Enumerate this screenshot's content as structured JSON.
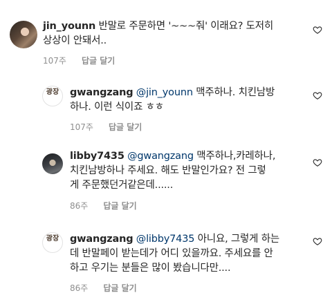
{
  "comments": [
    {
      "username": "jin_younn",
      "avatar": "profile-photo",
      "lines": [
        [
          {
            "t": "jin_younn",
            "k": "user"
          },
          {
            "t": " 반말로 주문하면 '~~~줘' 이래요? 도저히",
            "k": "text"
          }
        ],
        [
          {
            "t": "상상이 안돼서..",
            "k": "text"
          }
        ]
      ],
      "time": "107주",
      "reply": "답글 달기"
    },
    {
      "username": "gwangzang",
      "avatar": "brand-logo",
      "avatar_text": "광장",
      "lines": [
        [
          {
            "t": "gwangzang",
            "k": "user"
          },
          {
            "t": " @jin_younn",
            "k": "mention"
          },
          {
            "t": "  맥주하나. 치킨남방",
            "k": "text"
          }
        ],
        [
          {
            "t": "하나. 이런 식이죠 ㅎㅎ",
            "k": "text"
          }
        ]
      ],
      "time": "107주",
      "reply": "답글 달기"
    },
    {
      "username": "libby7435",
      "avatar": "profile-photo-dark",
      "lines": [
        [
          {
            "t": "libby7435",
            "k": "user"
          },
          {
            "t": " @gwangzang",
            "k": "mention"
          },
          {
            "t": "  맥주하나,카레하나,",
            "k": "text"
          }
        ],
        [
          {
            "t": "치킨남방하나  주세요. 해도 반말인가요? 전 그렇",
            "k": "text"
          }
        ],
        [
          {
            "t": "게 주문했던거같은데......",
            "k": "text"
          }
        ]
      ],
      "time": "86주",
      "reply": "답글 달기"
    },
    {
      "username": "gwangzang",
      "avatar": "brand-logo",
      "avatar_text": "광장",
      "lines": [
        [
          {
            "t": "gwangzang",
            "k": "user"
          },
          {
            "t": " @libby7435",
            "k": "mention"
          },
          {
            "t": " 아니요, 그렇게 하는",
            "k": "text"
          }
        ],
        [
          {
            "t": "데 반말페이 받는데가 어디 있을까요. 주세요를 안",
            "k": "text"
          }
        ],
        [
          {
            "t": "하고 우기는 분들은 많이 봤습니다만....",
            "k": "text"
          }
        ]
      ],
      "time": "86주",
      "reply": "답글 달기"
    }
  ],
  "colors": {
    "text": "#262626",
    "meta": "#8e8e8e",
    "mention": "#00376b",
    "background": "#ffffff"
  },
  "icons": {
    "like": "heart-outline-icon"
  }
}
